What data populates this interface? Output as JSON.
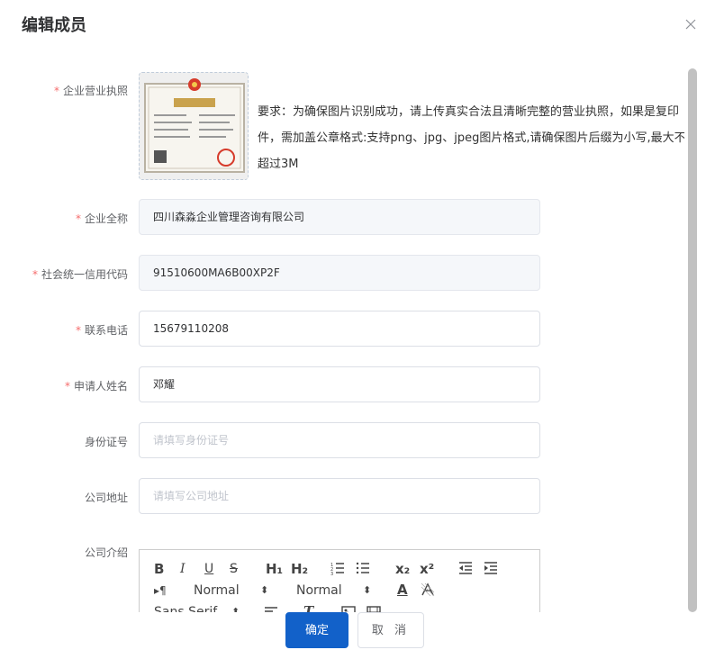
{
  "dialog": {
    "title": "编辑成员"
  },
  "form": {
    "license": {
      "label": "企业营业执照",
      "requirement": "要求：为确保图片识别成功，请上传真实合法且清晰完整的营业执照，如果是复印件，需加盖公章格式:支持png、jpg、jpeg图片格式,请确保图片后缀为小写,最大不超过3M"
    },
    "company_name": {
      "label": "企业全称",
      "value": "四川森淼企业管理咨询有限公司"
    },
    "credit_code": {
      "label": "社会统一信用代码",
      "value": "91510600MA6B00XP2F"
    },
    "phone": {
      "label": "联系电话",
      "value": "15679110208"
    },
    "applicant": {
      "label": "申请人姓名",
      "value": "邓耀"
    },
    "id_number": {
      "label": "身份证号",
      "placeholder": "请填写身份证号"
    },
    "address": {
      "label": "公司地址",
      "placeholder": "请填写公司地址"
    },
    "intro": {
      "label": "公司介绍"
    }
  },
  "editor": {
    "toolbar": {
      "bold": "B",
      "italic": "I",
      "underline": "U",
      "strike": "S",
      "h1": "H₁",
      "h2": "H₂",
      "sub": "x₂",
      "sup": "x²",
      "direction": "▸¶",
      "size_value": "Normal",
      "header_value": "Normal",
      "font_value": "Sans Serif",
      "color_a": "A",
      "clean": "T"
    }
  },
  "footer": {
    "confirm_label": "确定",
    "cancel_label": "取 消"
  },
  "colors": {
    "primary": "#1261c9",
    "required": "#f56c6c"
  }
}
